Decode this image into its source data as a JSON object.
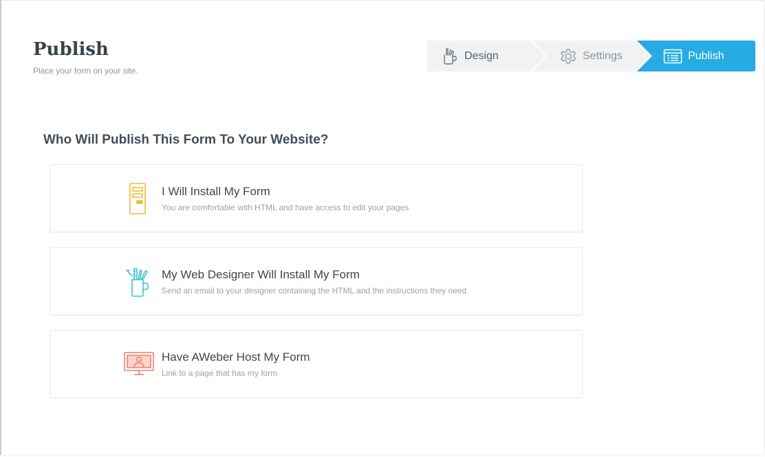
{
  "header": {
    "title": "Publish",
    "subtitle": "Place your form on your site."
  },
  "wizard": {
    "steps": [
      {
        "label": "Design",
        "icon": "design-tools-icon",
        "state": "complete"
      },
      {
        "label": "Settings",
        "icon": "gear-icon",
        "state": "inactive"
      },
      {
        "label": "Publish",
        "icon": "window-icon",
        "state": "active"
      }
    ],
    "active_color": "#26abe2"
  },
  "main": {
    "heading": "Who Will Publish This Form To Your Website?",
    "options": [
      {
        "title": "I Will Install My Form",
        "description": "You are comfortable with HTML and have access to edit your pages",
        "icon": "form-document-icon",
        "icon_color": "#f5b731"
      },
      {
        "title": "My Web Designer Will Install My Form",
        "description": "Send an email to your designer containing the HTML and the instructions they need",
        "icon": "designer-cup-icon",
        "icon_color": "#3cc3cf"
      },
      {
        "title": "Have AWeber Host My Form",
        "description": "Link to a page that has my form",
        "icon": "hosted-monitor-icon",
        "icon_color": "#f07f6a"
      }
    ]
  }
}
